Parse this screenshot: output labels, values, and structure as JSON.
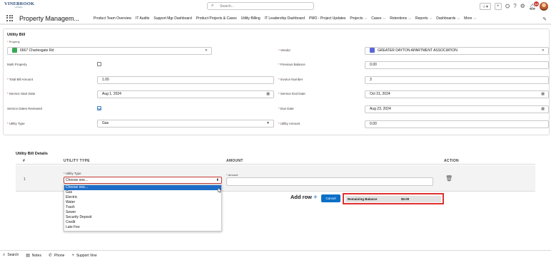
{
  "header": {
    "logo_text": "VINEBROOK",
    "logo_subtext": "HOMES",
    "search_placeholder": "Search...",
    "notification_count": "14"
  },
  "nav": {
    "app_name": "Property Managem...",
    "items": [
      {
        "label": "Product Team Overview",
        "has_menu": false
      },
      {
        "label": "IT Audits",
        "has_menu": false
      },
      {
        "label": "Support Mgr Dashboard",
        "has_menu": false
      },
      {
        "label": "Product Projects & Cases",
        "has_menu": false
      },
      {
        "label": "Utility Billing",
        "has_menu": false
      },
      {
        "label": "IT Leadership Dashboard",
        "has_menu": false
      },
      {
        "label": "PMO - Project Updates",
        "has_menu": false
      },
      {
        "label": "Projects",
        "has_menu": true
      },
      {
        "label": "Cases",
        "has_menu": true
      },
      {
        "label": "Retentions",
        "has_menu": true
      },
      {
        "label": "Reports",
        "has_menu": true
      },
      {
        "label": "Dashboards",
        "has_menu": true
      },
      {
        "label": "More",
        "has_menu": true
      }
    ]
  },
  "form": {
    "title": "Utility Bill",
    "property_label": "Property",
    "property_value": "6667 Charlesgate Rd",
    "vendor_label": "Vendor",
    "vendor_value": "GREATER DAYTON APARTMENT ASSOCIATION",
    "multi_property_label": "Multi Property",
    "multi_property_checked": false,
    "previous_balance_label": "Previous Balance",
    "previous_balance_value": "0.00",
    "total_bill_label": "Total Bill Amount",
    "total_bill_value": "1.00",
    "invoice_number_label": "Invoice Number",
    "invoice_number_value": "3",
    "service_start_label": "Service Start Date",
    "service_start_value": "Aug 1, 2024",
    "service_end_label": "Service End Date",
    "service_end_value": "Oct 31, 2024",
    "service_reviewed_label": "Service Dates Reviewed",
    "service_reviewed_checked": true,
    "due_date_label": "Due Date",
    "due_date_value": "Aug 23, 2024",
    "utility_type_label": "Utility Type",
    "utility_type_value": "Gas",
    "utility_amount_label": "Utility Amount",
    "utility_amount_value": "0.00"
  },
  "details": {
    "title": "Utility Bill Details",
    "col_num": "#",
    "col_type": "UTILITY TYPE",
    "col_amount": "AMOUNT",
    "col_action": "ACTION",
    "row_number": "1",
    "row_type_label": "Utility Type",
    "row_type_value": "Choose one...",
    "row_amount_label": "Amount",
    "options": [
      "Choose one...",
      "Gas",
      "Electric",
      "Water",
      "Trash",
      "Sewer",
      "Security Deposit",
      "Credit",
      "Late Fee"
    ],
    "add_row_label": "Add row",
    "cancel_label": "Cancel",
    "remaining_label": "Remaining Balance",
    "remaining_value": "$0.00"
  },
  "bottom": {
    "items": [
      "Search",
      "Notes",
      "Phone",
      "Support Vine"
    ]
  }
}
